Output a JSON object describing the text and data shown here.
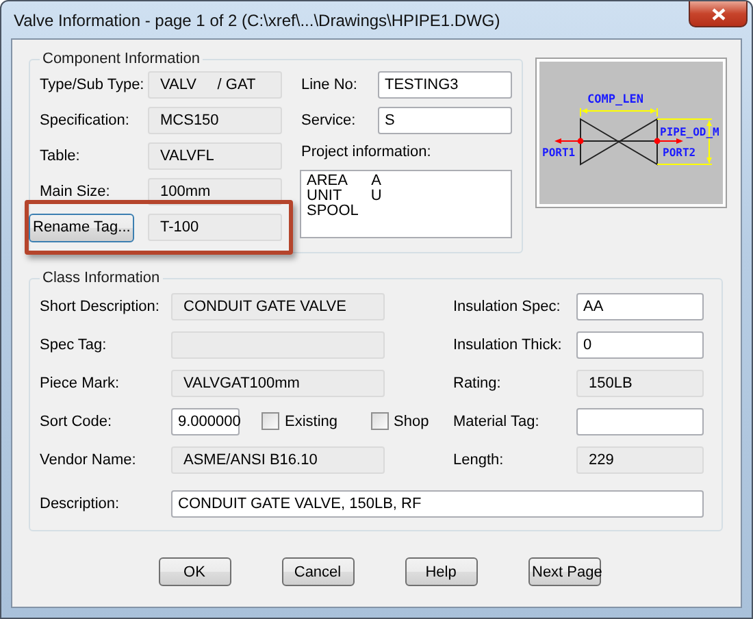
{
  "window": {
    "title": "Valve Information - page 1 of 2 (C:\\xref\\...\\Drawings\\HPIPE1.DWG)"
  },
  "component_information": {
    "title": "Component Information",
    "highlighted": true,
    "left_fields": [
      {
        "label": "Type/Sub Type:",
        "value": "VALV     / GAT",
        "readonly": true
      },
      {
        "label": "Specification:",
        "value": "MCS150",
        "readonly": true
      },
      {
        "label": "Table:",
        "value": "VALVFL",
        "readonly": true
      },
      {
        "label": "Main Size:",
        "value": "100mm",
        "readonly": true
      }
    ],
    "rename_tag_button": "Rename Tag...",
    "tag_value": "T-100",
    "right_fields": [
      {
        "label": "Line No:",
        "value": "TESTING3",
        "readonly": false
      },
      {
        "label": "Service:",
        "value": "S",
        "readonly": false
      }
    ],
    "project_information": {
      "label": "Project information:",
      "lines": [
        "AREA      A",
        "UNIT       U",
        "SPOOL"
      ]
    }
  },
  "preview": {
    "dimension_labels": [
      "COMP_LEN",
      "PIPE_OD_M"
    ],
    "port_labels": [
      "PORT1",
      "PORT2"
    ]
  },
  "class_information": {
    "title": "Class Information",
    "left_rows": [
      {
        "kind": "field",
        "label": "Short Description:",
        "value": "CONDUIT GATE VALVE",
        "readonly": true
      },
      {
        "kind": "field",
        "label": "Spec Tag:",
        "readonly": true
      },
      {
        "kind": "field",
        "label": "Piece Mark:",
        "value": "VALVGAT100mm",
        "readonly": true
      },
      {
        "kind": "sort",
        "label": "Sort Code:",
        "value": "9.000000",
        "readonly": false,
        "checkboxes": [
          {
            "label": "Existing",
            "checked": false
          },
          {
            "label": "Shop",
            "checked": false
          }
        ]
      },
      {
        "kind": "field",
        "label": "Vendor Name:",
        "value": "ASME/ANSI B16.10",
        "readonly": true
      }
    ],
    "right_rows": [
      {
        "label": "Insulation Spec:",
        "value": "AA",
        "readonly": false
      },
      {
        "label": "Insulation Thick:",
        "value": "0",
        "readonly": false
      },
      {
        "label": "Rating:",
        "value": "150LB",
        "readonly": true
      },
      {
        "label": "Material Tag:",
        "readonly": false
      },
      {
        "label": "Length:",
        "value": "229",
        "readonly": true
      }
    ],
    "description": {
      "label": "Description:",
      "value": "CONDUIT GATE VALVE, 150LB, RF",
      "readonly": false
    }
  },
  "buttons": [
    "OK",
    "Cancel",
    "Help",
    "Next Page"
  ]
}
